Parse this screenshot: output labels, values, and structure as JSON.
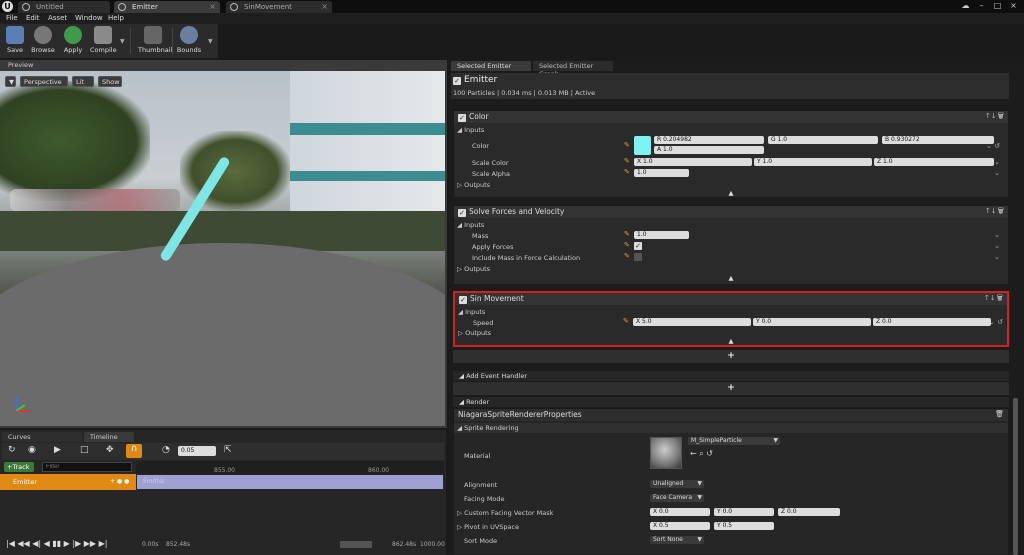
{
  "titlebar": {
    "tabs": [
      {
        "label": "Untitled"
      },
      {
        "label": "Emitter"
      },
      {
        "label": "SinMovement"
      }
    ]
  },
  "menu": [
    "File",
    "Edit",
    "Asset",
    "Window",
    "Help"
  ],
  "toolbar": {
    "buttons": [
      "Save",
      "Browse",
      "Apply",
      "Compile",
      "Thumbnail",
      "Bounds"
    ]
  },
  "preview": {
    "tab": "Preview",
    "view_mode": "Perspective",
    "lit_mode": "Lit",
    "show": "Show"
  },
  "bottom": {
    "tabs": [
      "Curves",
      "Timeline"
    ],
    "time_step": "0.05",
    "track_label": "Track",
    "filter_placeholder": "Filter",
    "tick1": "855.00",
    "tick2": "860.00",
    "emitter_row": "Emitter",
    "emitter_bar": "Emitter",
    "footer": {
      "t0": "0.00s",
      "t1": "852.48s",
      "t2": "862.48s",
      "t3": "1000.00"
    }
  },
  "right": {
    "tabs": [
      "Selected Emitter",
      "Selected Emitter Graph"
    ],
    "emitter_title": "Emitter",
    "emitter_stats": "100 Particles | 0.034 ms | 0.013 MB | Active",
    "inputs": "Inputs",
    "outputs": "Outputs",
    "color_module": {
      "title": "Color",
      "color_label": "Color",
      "swatch": "#7ff2f2",
      "r": "R  0.204982",
      "g": "G  1.0",
      "b": "B  0.930272",
      "a": "A  1.0",
      "scale_color_label": "Scale Color",
      "sx": "X  1.0",
      "sy": "Y  1.0",
      "sz": "Z  1.0",
      "scale_alpha_label": "Scale Alpha",
      "sa": "1.0"
    },
    "solve_module": {
      "title": "Solve Forces and Velocity",
      "mass_label": "Mass",
      "mass": "1.0",
      "apply_label": "Apply Forces",
      "include_label": "Include Mass in Force Calculation"
    },
    "sin_module": {
      "title": "Sin Movement",
      "speed_label": "Speed",
      "x": "X  5.0",
      "y": "Y  0.0",
      "z": "Z  0.0",
      "highlight": "#d42020"
    },
    "add_event": "Add Event Handler",
    "render": "Render",
    "renderer_props": "NiagaraSpriteRendererProperties",
    "sprite_rendering": "Sprite Rendering",
    "material_label": "Material",
    "material_value": "M_SimpleParticle",
    "alignment_label": "Alignment",
    "alignment_value": "Unaligned",
    "facing_label": "Facing Mode",
    "facing_value": "Face Camera",
    "cfv_label": "Custom Facing Vector Mask",
    "cfv": {
      "x": "X  0.0",
      "y": "Y  0.0",
      "z": "Z  0.0"
    },
    "pivot_label": "Pivot in UVSpace",
    "pivot": {
      "x": "X  0.5",
      "y": "Y  0.5"
    },
    "sort_label": "Sort Mode",
    "sort_value": "Sort None"
  }
}
